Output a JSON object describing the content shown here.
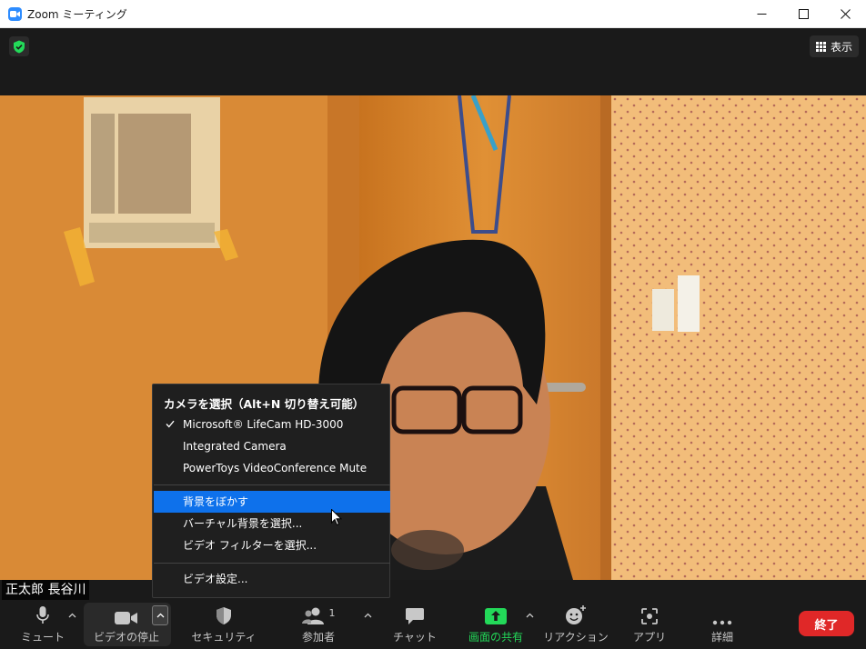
{
  "window": {
    "title": "Zoom ミーティング"
  },
  "topbar": {
    "view_label": "表示"
  },
  "participant": {
    "name": "正太郎 長谷川"
  },
  "camera_menu": {
    "header": "カメラを選択（Alt+N 切り替え可能）",
    "cameras": [
      {
        "label": "Microsoft® LifeCam HD-3000",
        "checked": true
      },
      {
        "label": "Integrated Camera",
        "checked": false
      },
      {
        "label": "PowerToys VideoConference Mute",
        "checked": false
      }
    ],
    "background_items": [
      {
        "label": "背景をぼかす",
        "highlighted": true
      },
      {
        "label": "バーチャル背景を選択...",
        "highlighted": false
      },
      {
        "label": "ビデオ フィルターを選択...",
        "highlighted": false
      }
    ],
    "settings_label": "ビデオ設定..."
  },
  "toolbar": {
    "mute_label": "ミュート",
    "video_label": "ビデオの停止",
    "security_label": "セキュリティ",
    "participants_label": "参加者",
    "participants_count": "1",
    "chat_label": "チャット",
    "share_label": "画面の共有",
    "reactions_label": "リアクション",
    "apps_label": "アプリ",
    "more_label": "詳細",
    "end_label": "終了"
  },
  "colors": {
    "accent": "#0e71eb",
    "share_green": "#23d959",
    "end_red": "#e02828",
    "dark_bg": "#1a1a1a"
  }
}
